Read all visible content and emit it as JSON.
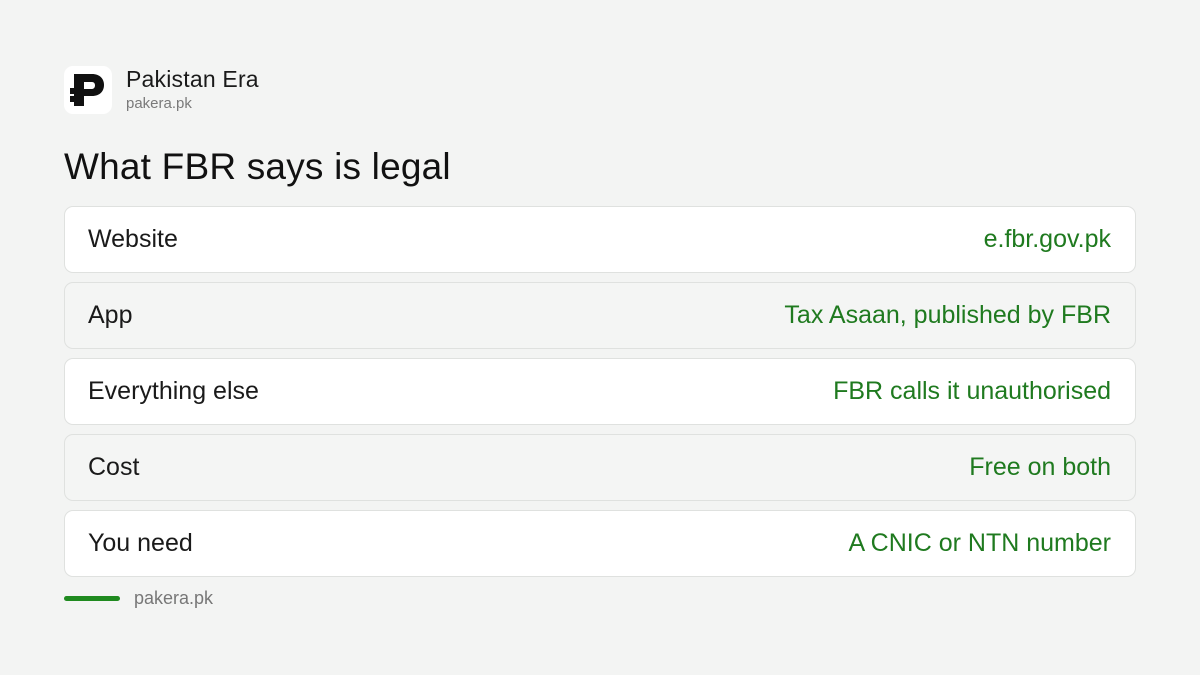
{
  "brand": {
    "name": "Pakistan Era",
    "url": "pakera.pk",
    "logo_icon": "pakistan-era-logo-icon"
  },
  "title": "What FBR says is legal",
  "rows": [
    {
      "label": "Website",
      "value": "e.fbr.gov.pk"
    },
    {
      "label": "App",
      "value": "Tax Asaan, published by FBR"
    },
    {
      "label": "Everything else",
      "value": "FBR calls it unauthorised"
    },
    {
      "label": "Cost",
      "value": "Free on both"
    },
    {
      "label": "You need",
      "value": "A CNIC or NTN number"
    }
  ],
  "footer": {
    "url": "pakera.pk"
  },
  "colors": {
    "accent": "#1f7a1f",
    "background": "#f3f4f3",
    "card": "#ffffff",
    "card_alt": "#f4f5f4"
  }
}
